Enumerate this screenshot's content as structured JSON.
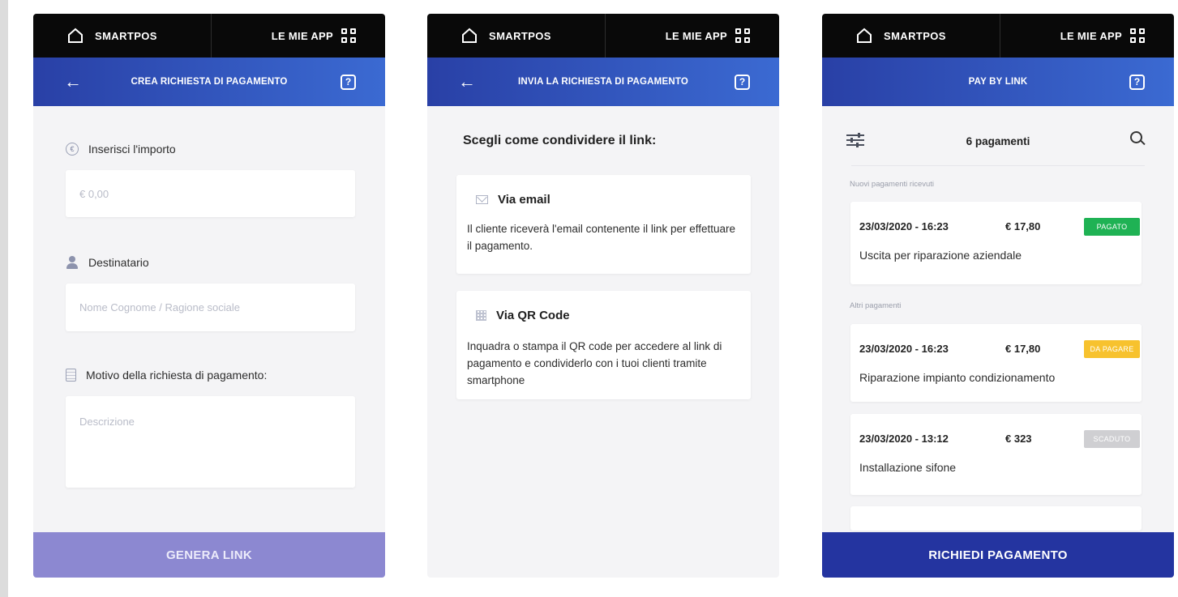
{
  "brand": "SMARTPOS",
  "apps_label": "LE MIE APP",
  "screen1": {
    "nav_title": "CREA RICHIESTA DI PAGAMENTO",
    "help": "?",
    "amount_label": "Inserisci l'importo",
    "amount_placeholder": "€ 0,00",
    "recipient_label": "Destinatario",
    "recipient_placeholder": "Nome Cognome / Ragione sociale",
    "reason_label": "Motivo della richiesta di pagamento:",
    "description_placeholder": "Descrizione",
    "cta": "GENERA LINK"
  },
  "screen2": {
    "nav_title": "INVIA LA RICHIESTA DI PAGAMENTO",
    "help": "?",
    "heading": "Scegli come condividere il link:",
    "options": [
      {
        "title": "Via email",
        "icon": "mail-icon",
        "description": "Il cliente riceverà l'email contenente il link per effettuare il pagamento."
      },
      {
        "title": "Via QR Code",
        "icon": "qr-code-icon",
        "description": "Inquadra o stampa il QR code per accedere al link di pagamento e condividerlo con i tuoi clienti tramite smartphone"
      }
    ]
  },
  "screen3": {
    "nav_title": "PAY BY LINK",
    "help": "?",
    "count": "6 pagamenti",
    "section_new": "Nuovi pagamenti ricevuti",
    "section_other": "Altri pagamenti",
    "payments": [
      {
        "date": "23/03/2020 - 16:23",
        "amount": "€ 17,80",
        "status": "PAGATO",
        "status_color": "#1fb254",
        "description": "Uscita per riparazione aziendale"
      },
      {
        "date": "23/03/2020 - 16:23",
        "amount": "€ 17,80",
        "status": "DA PAGARE",
        "status_color": "#f7c22e",
        "description": "Riparazione impianto condizionamento"
      },
      {
        "date": "23/03/2020 - 13:12",
        "amount": "€ 323",
        "status": "SCADUTO",
        "status_color": "#cfcfd2",
        "description": "Installazione sifone"
      }
    ],
    "cta": "RICHIEDI PAGAMENTO"
  },
  "colors": {
    "nav_start": "#2940a6",
    "nav_end": "#3b6ad2",
    "cta_light": "#8c88d1",
    "cta_dark": "#2434a0"
  }
}
